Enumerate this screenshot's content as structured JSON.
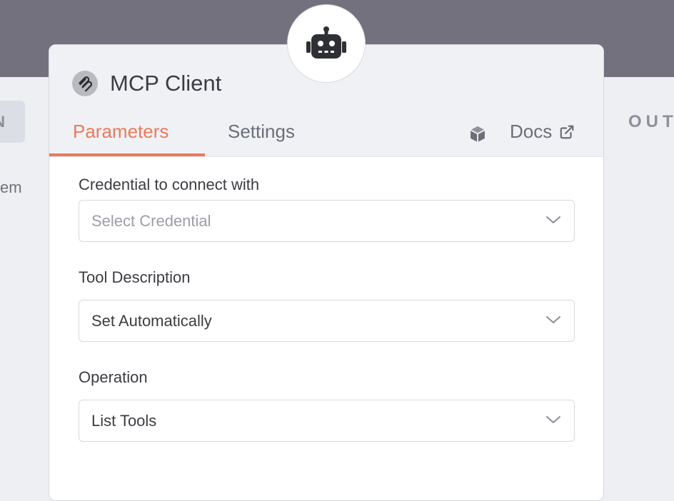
{
  "background": {
    "left_button_text": "N",
    "left_text": "em",
    "output_label": "OUT"
  },
  "node": {
    "title": "MCP Client",
    "tabs": [
      {
        "label": "Parameters",
        "active": true
      },
      {
        "label": "Settings",
        "active": false
      }
    ],
    "docs_label": "Docs",
    "icons": {
      "node": "robot-icon",
      "title": "mcp-icon",
      "package": "cube-icon",
      "external": "external-link-icon"
    }
  },
  "fields": [
    {
      "label": "Credential to connect with",
      "value": "",
      "placeholder": "Select Credential"
    },
    {
      "label": "Tool Description",
      "value": "Set Automatically",
      "placeholder": ""
    },
    {
      "label": "Operation",
      "value": "List Tools",
      "placeholder": ""
    }
  ],
  "colors": {
    "accent": "#ea7a5a",
    "backdrop": "#72717d",
    "text": "#3c3d42",
    "muted": "#6c6f77"
  }
}
